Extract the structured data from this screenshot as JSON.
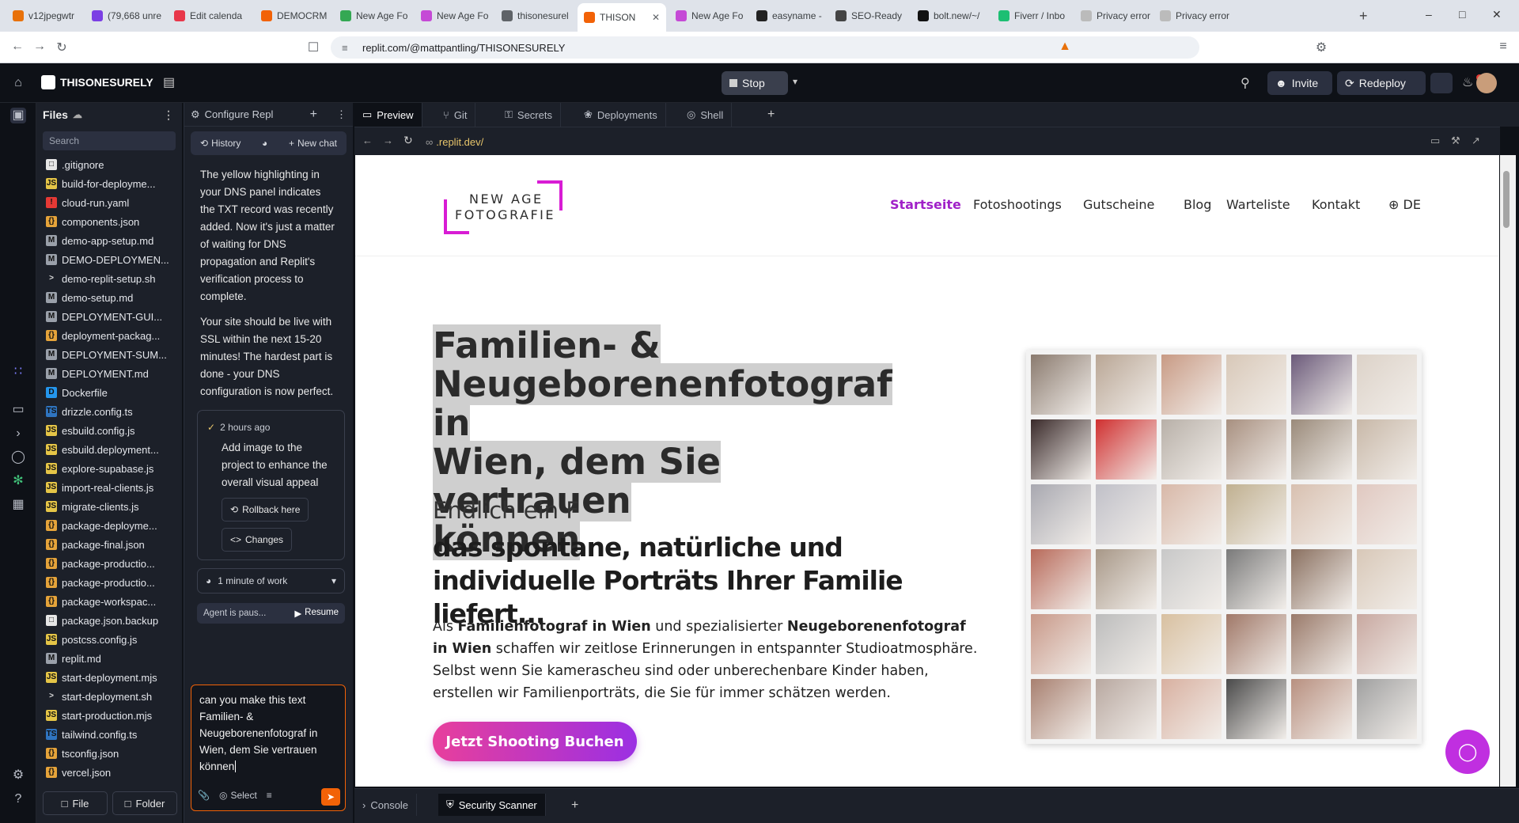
{
  "browser": {
    "tabs": [
      {
        "label": "v12jpegwtr",
        "color": "#e8710a"
      },
      {
        "label": "(79,668 unre",
        "color": "#7b3fe4"
      },
      {
        "label": "Edit calenda",
        "color": "#e8374a"
      },
      {
        "label": "DEMOCRM",
        "color": "#f26207"
      },
      {
        "label": "New Age Fo",
        "color": "#34a853"
      },
      {
        "label": "New Age Fo",
        "color": "#c54ad6"
      },
      {
        "label": "thisonesurel",
        "color": "#5f6368"
      },
      {
        "label": "THISON",
        "color": "#f26207"
      },
      {
        "label": "New Age Fo",
        "color": "#c54ad6"
      },
      {
        "label": "easyname -",
        "color": "#222222"
      },
      {
        "label": "SEO-Ready",
        "color": "#444444"
      },
      {
        "label": "bolt.new/~/",
        "color": "#111111"
      },
      {
        "label": "Fiverr / Inbo",
        "color": "#1dbf73"
      },
      {
        "label": "Privacy error",
        "color": "#bbbbbb"
      },
      {
        "label": "Privacy error",
        "color": "#bbbbbb"
      }
    ],
    "url": "replit.com/@mattpantling/THISONESURELY"
  },
  "replit": {
    "project_name": "THISONESURELY",
    "stop_label": "Stop",
    "invite_label": "Invite",
    "redeploy_label": "Redeploy"
  },
  "files": {
    "title": "Files",
    "search_placeholder": "Search",
    "items": [
      {
        "name": ".gitignore",
        "kind": "doc"
      },
      {
        "name": "build-for-deployme...",
        "kind": "js"
      },
      {
        "name": "cloud-run.yaml",
        "kind": "yaml"
      },
      {
        "name": "components.json",
        "kind": "json"
      },
      {
        "name": "demo-app-setup.md",
        "kind": "md"
      },
      {
        "name": "DEMO-DEPLOYMEN...",
        "kind": "md"
      },
      {
        "name": "demo-replit-setup.sh",
        "kind": "sh"
      },
      {
        "name": "demo-setup.md",
        "kind": "md"
      },
      {
        "name": "DEPLOYMENT-GUI...",
        "kind": "md"
      },
      {
        "name": "deployment-packag...",
        "kind": "json"
      },
      {
        "name": "DEPLOYMENT-SUM...",
        "kind": "md"
      },
      {
        "name": "DEPLOYMENT.md",
        "kind": "md"
      },
      {
        "name": "Dockerfile",
        "kind": "docker"
      },
      {
        "name": "drizzle.config.ts",
        "kind": "ts"
      },
      {
        "name": "esbuild.config.js",
        "kind": "js"
      },
      {
        "name": "esbuild.deployment...",
        "kind": "js"
      },
      {
        "name": "explore-supabase.js",
        "kind": "js"
      },
      {
        "name": "import-real-clients.js",
        "kind": "js"
      },
      {
        "name": "migrate-clients.js",
        "kind": "js"
      },
      {
        "name": "package-deployme...",
        "kind": "json"
      },
      {
        "name": "package-final.json",
        "kind": "json"
      },
      {
        "name": "package-productio...",
        "kind": "json"
      },
      {
        "name": "package-productio...",
        "kind": "json"
      },
      {
        "name": "package-workspac...",
        "kind": "json"
      },
      {
        "name": "package.json.backup",
        "kind": "doc"
      },
      {
        "name": "postcss.config.js",
        "kind": "js"
      },
      {
        "name": "replit.md",
        "kind": "md"
      },
      {
        "name": "start-deployment.mjs",
        "kind": "js"
      },
      {
        "name": "start-deployment.sh",
        "kind": "sh"
      },
      {
        "name": "start-production.mjs",
        "kind": "js"
      },
      {
        "name": "tailwind.config.ts",
        "kind": "ts"
      },
      {
        "name": "tsconfig.json",
        "kind": "json"
      },
      {
        "name": "vercel.json",
        "kind": "json"
      }
    ],
    "new_file_label": "File",
    "new_folder_label": "Folder"
  },
  "agent": {
    "header": "Configure Repl",
    "history_label": "History",
    "new_chat_label": "New chat",
    "message1": "The yellow highlighting in your DNS panel indicates the TXT record was recently added. Now it's just a matter of waiting for DNS propagation and Replit's verification process to complete.",
    "message2": "Your site should be live with SSL within the next 15-20 minutes! The hardest part is done - your DNS configuration is now perfect.",
    "checkpoint_time": "2 hours ago",
    "checkpoint_text": "Add image to the project to enhance the overall visual appeal",
    "rollback_label": "Rollback here",
    "changes_label": "Changes",
    "work_label": "1 minute of work",
    "paused_label": "Agent is paus...",
    "resume_label": "Resume",
    "input_text": "can you make this text Familien- & Neugeborenenfotograf in Wien, dem Sie vertrauen können",
    "select_label": "Select"
  },
  "workspace": {
    "tabs": [
      "Preview",
      "Git",
      "Secrets",
      "Deployments",
      "Shell"
    ],
    "preview_url": ".replit.dev/",
    "bottom_tabs": [
      "Console",
      "Security Scanner"
    ]
  },
  "site": {
    "logo_line1": "NEW AGE",
    "logo_line2": "FOTOGRAFIE",
    "nav": [
      "Startseite",
      "Fotoshootings",
      "Gutscheine",
      "Blog",
      "Warteliste",
      "Kontakt",
      "DE"
    ],
    "accent": "#a020c8",
    "h1_lines": [
      "Familien- &",
      "Neugeborenenfotograf in",
      "Wien, dem Sie vertrauen",
      "können"
    ],
    "subtitle": "Endlich ein F",
    "h2": "das spontane, natürliche und individuelle Porträts Ihrer Familie liefert...",
    "para_prefix": "Als ",
    "para_bold1": "Familienfotograf in Wien",
    "para_mid": " und spezialisierter ",
    "para_bold2": "Neugeborenenfotograf in Wien",
    "para_rest": " schaffen wir zeitlose Erinnerungen in entspannter Studioatmosphäre. Selbst wenn Sie kamerascheu sind oder unberechenbare Kinder haben, erstellen wir Familienporträts, die Sie für immer schätzen werden.",
    "cta": "Jetzt Shooting Buchen",
    "photo_tones": [
      "#8a7a6e",
      "#b9a695",
      "#c89a84",
      "#d8c8b8",
      "#6b5a7a",
      "#dcd2c8",
      "#3a2a2a",
      "#d03030",
      "#b8b0a8",
      "#a89080",
      "#9a8a7a",
      "#c8b8a8",
      "#a8a8b0",
      "#c0c0c8",
      "#d8b8a8",
      "#c0b090",
      "#d8c0b0",
      "#e0c8c0",
      "#b86a5a",
      "#a89888",
      "#c8c8c8",
      "#7a7a7a",
      "#8a7060",
      "#d8c8b8",
      "#c89888",
      "#bcbcbc",
      "#d8c0a0",
      "#a07868",
      "#9a7a6a",
      "#c8a8a0",
      "#a88070",
      "#b8a8a0",
      "#d8b0a0",
      "#4a4a4a",
      "#b89080",
      "#a0a0a0"
    ]
  }
}
